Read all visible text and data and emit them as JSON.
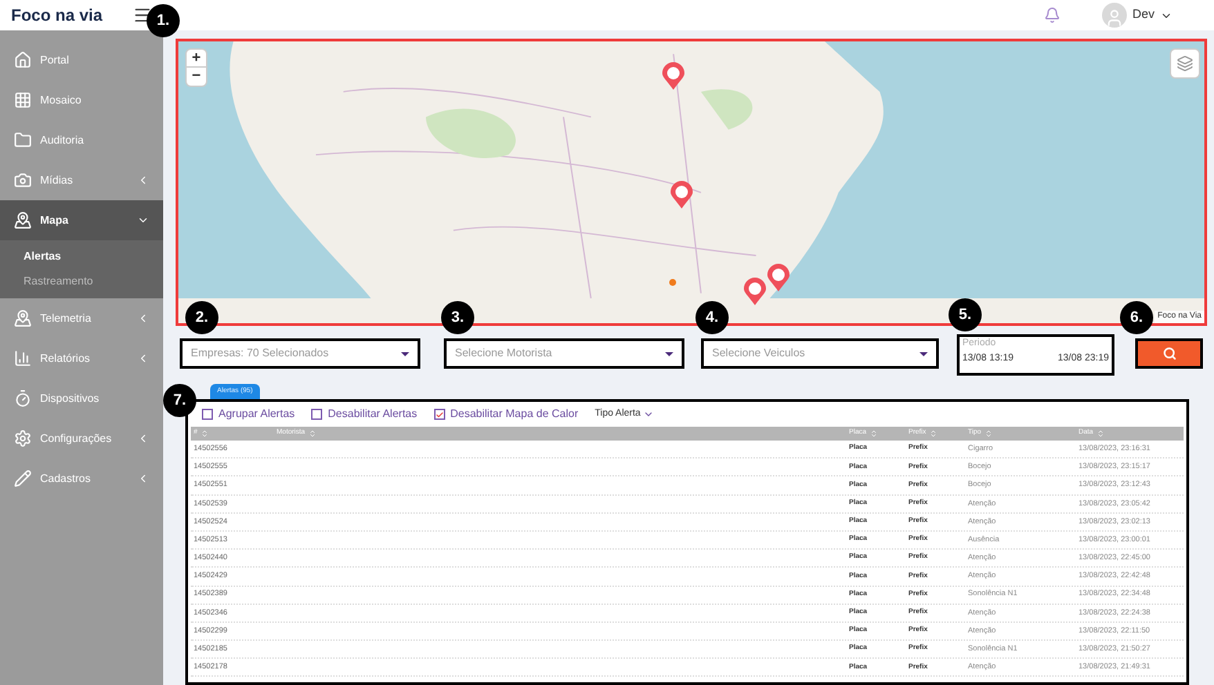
{
  "header": {
    "logo": "Foco na via",
    "user": "Dev"
  },
  "callouts": [
    "1.",
    "2.",
    "3.",
    "4.",
    "5.",
    "6.",
    "7."
  ],
  "sidebar": {
    "items": [
      {
        "label": "Portal",
        "selected": false
      },
      {
        "label": "Mosaico",
        "selected": false
      },
      {
        "label": "Auditoria",
        "selected": false
      },
      {
        "label": "Mídias",
        "expanded": false,
        "selected": false
      },
      {
        "label": "Mapa",
        "expanded": true,
        "selected": true,
        "children": [
          {
            "label": "Alertas",
            "selected": true
          },
          {
            "label": "Rastreamento",
            "selected": false
          }
        ]
      },
      {
        "label": "Telemetria",
        "expanded": false,
        "selected": false
      },
      {
        "label": "Relatórios",
        "expanded": false,
        "selected": false
      },
      {
        "label": "Dispositivos",
        "selected": false
      },
      {
        "label": "Configurações",
        "expanded": false,
        "selected": false
      },
      {
        "label": "Cadastros",
        "expanded": false,
        "selected": false
      }
    ]
  },
  "map": {
    "zoom_in": "+",
    "zoom_out": "−",
    "attribution": "Foco na Via"
  },
  "filters": {
    "empresas": {
      "value": "Empresas: 70 Selecionados"
    },
    "motorista": {
      "placeholder": "Selecione Motorista"
    },
    "veiculos": {
      "placeholder": "Selecione Veiculos"
    },
    "periodo": {
      "label": "Periodo",
      "start": "13/08 13:19",
      "end": "13/08 23:19"
    }
  },
  "tabs": [
    {
      "label": "Alertas (95)",
      "selected": true
    }
  ],
  "options": [
    {
      "label": "Agrupar Alertas",
      "checked": false
    },
    {
      "label": "Desabilitar Alertas",
      "checked": false
    },
    {
      "label": "Desabilitar Mapa de Calor",
      "checked": true
    }
  ],
  "tipo_alerta": "Tipo Alerta",
  "table": {
    "columns": [
      "#",
      "Motorista",
      "Placa",
      "Prefix",
      "Tipo",
      "Data"
    ],
    "rows": [
      [
        "14502556",
        "",
        "Placa",
        "Prefix",
        "Cigarro",
        "13/08/2023, 23:16:31"
      ],
      [
        "14502555",
        "",
        "Placa",
        "Prefix",
        "Bocejo",
        "13/08/2023, 23:15:17"
      ],
      [
        "14502551",
        "",
        "Placa",
        "Prefix",
        "Bocejo",
        "13/08/2023, 23:12:43"
      ],
      [
        "14502539",
        "",
        "Placa",
        "Prefix",
        "Atenção",
        "13/08/2023, 23:05:42"
      ],
      [
        "14502524",
        "",
        "Placa",
        "Prefix",
        "Atenção",
        "13/08/2023, 23:02:13"
      ],
      [
        "14502513",
        "",
        "Placa",
        "Prefix",
        "Ausência",
        "13/08/2023, 23:00:01"
      ],
      [
        "14502440",
        "",
        "Placa",
        "Prefix",
        "Atenção",
        "13/08/2023, 22:45:00"
      ],
      [
        "14502429",
        "",
        "Placa",
        "Prefix",
        "Atenção",
        "13/08/2023, 22:42:48"
      ],
      [
        "14502389",
        "",
        "Placa",
        "Prefix",
        "Sonolência N1",
        "13/08/2023, 22:34:48"
      ],
      [
        "14502346",
        "",
        "Placa",
        "Prefix",
        "Atenção",
        "13/08/2023, 22:24:38"
      ],
      [
        "14502299",
        "",
        "Placa",
        "Prefix",
        "Atenção",
        "13/08/2023, 22:11:50"
      ],
      [
        "14502185",
        "",
        "Placa",
        "Prefix",
        "Sonolência N1",
        "13/08/2023, 21:50:27"
      ],
      [
        "14502178",
        "",
        "Placa",
        "Prefix",
        "Atenção",
        "13/08/2023, 21:49:31"
      ]
    ]
  }
}
